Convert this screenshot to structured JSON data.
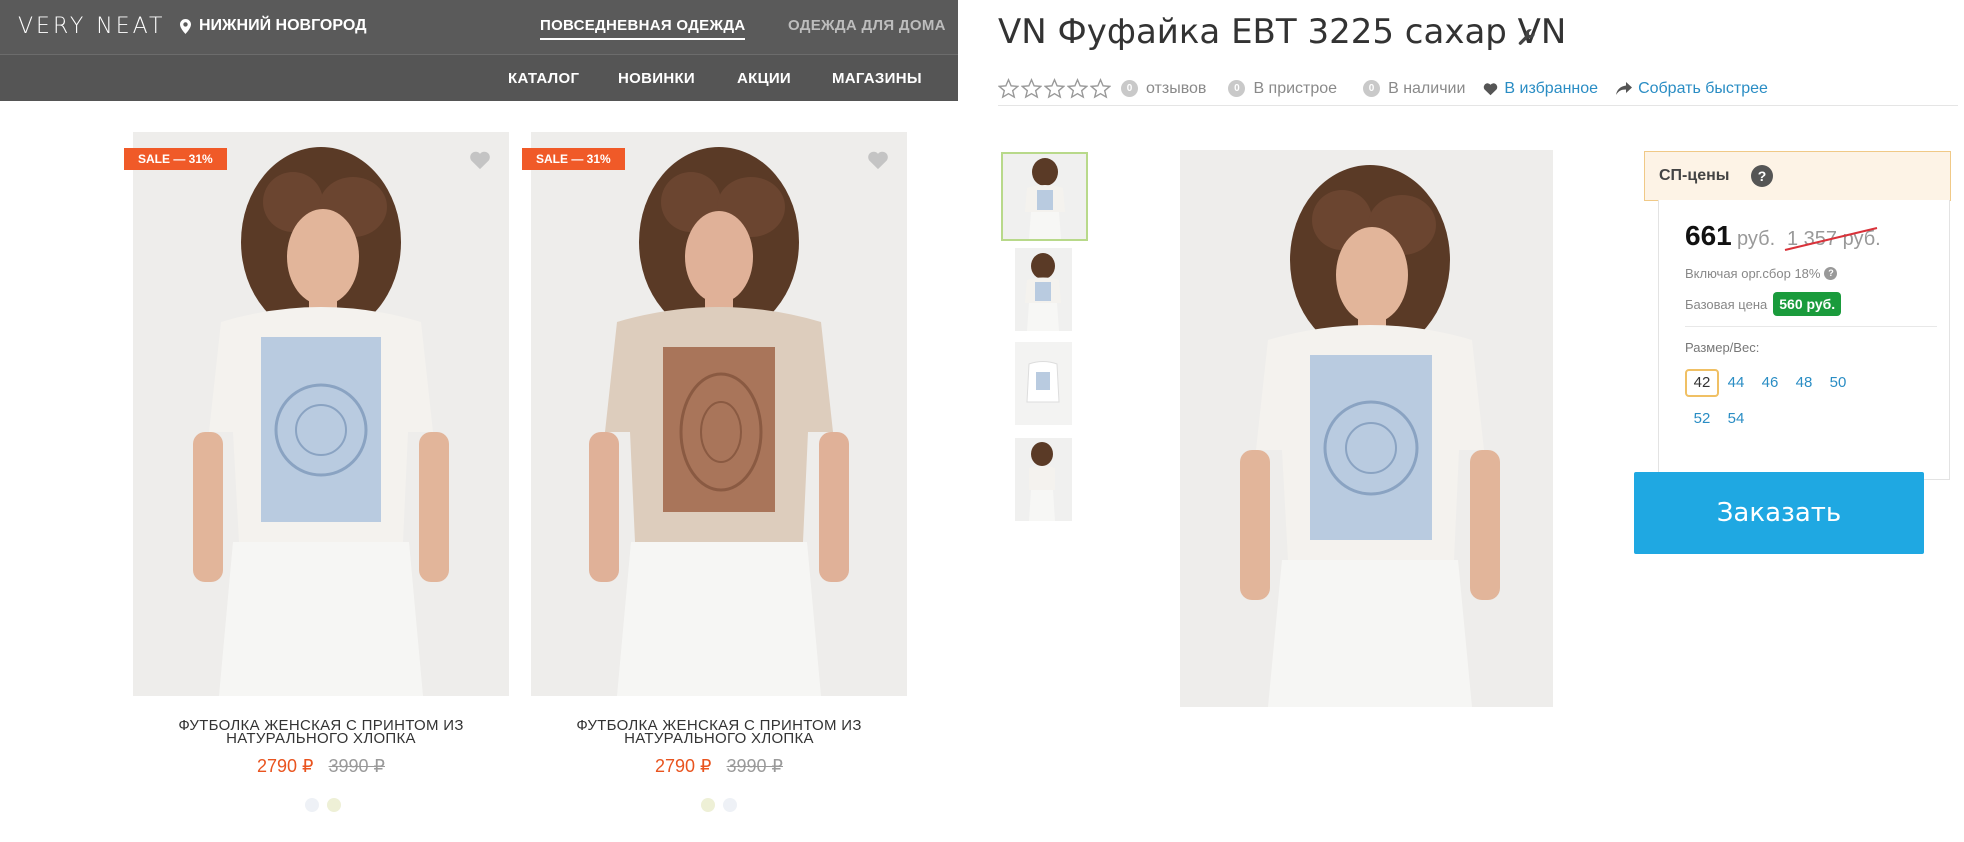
{
  "header": {
    "logo": "VERY NEAT",
    "city": "НИЖНИЙ НОВГОРОД",
    "category_tabs": [
      "ПОВСЕДНЕВНАЯ ОДЕЖДА",
      "ОДЕЖДА ДЛЯ ДОМА"
    ],
    "nav": [
      "КАТАЛОГ",
      "НОВИНКИ",
      "АКЦИИ",
      "МАГАЗИНЫ"
    ]
  },
  "products": [
    {
      "badge": "SALE — 31%",
      "title_line1": "ФУТБОЛКА ЖЕНСКАЯ С ПРИНТОМ ИЗ",
      "title_line2": "НАТУРАЛЬНОГО ХЛОПКА",
      "price": "2790 ₽",
      "old_price": "3990 ₽",
      "print_color": "#b9cbe0",
      "tshirt_color": "#f4f2ee",
      "swatches": [
        "#eef1f6",
        "#eef0d6"
      ]
    },
    {
      "badge": "SALE — 31%",
      "title_line1": "ФУТБОЛКА ЖЕНСКАЯ С ПРИНТОМ ИЗ",
      "title_line2": "НАТУРАЛЬНОГО ХЛОПКА",
      "price": "2790 ₽",
      "old_price": "3990 ₽",
      "print_color": "#a9755a",
      "tshirt_color": "#ddcdbd",
      "swatches": [
        "#eef0d6",
        "#eef1f6"
      ]
    }
  ],
  "detail": {
    "title": "VN Фуфайка ЕВТ 3225 сахар VN",
    "rating_stars": 0,
    "reviews_count": "0",
    "reviews_label": "отзывов",
    "attach_count": "0",
    "attach_label": "В пристрое",
    "stock_count": "0",
    "stock_label": "В наличии",
    "favorite_label": "В избранное",
    "collect_label": "Собрать быстрее",
    "sp_label": "СП-цены",
    "sp_help": "?",
    "price": "661",
    "currency": "руб.",
    "old_price": "1 357 руб.",
    "included_fee": "Включая орг.сбор 18%",
    "base_price_label": "Базовая цена",
    "base_price": "560 руб.",
    "size_label": "Размер/Вес:",
    "sizes": [
      "42",
      "44",
      "46",
      "48",
      "50",
      "52",
      "54"
    ],
    "selected_size": "42",
    "order_button": "Заказать"
  },
  "colors": {
    "sale": "#f05a28",
    "price": "#e9541f",
    "link": "#2a8dc4",
    "order": "#1fa8e2",
    "base_badge": "#1a9b3c"
  }
}
